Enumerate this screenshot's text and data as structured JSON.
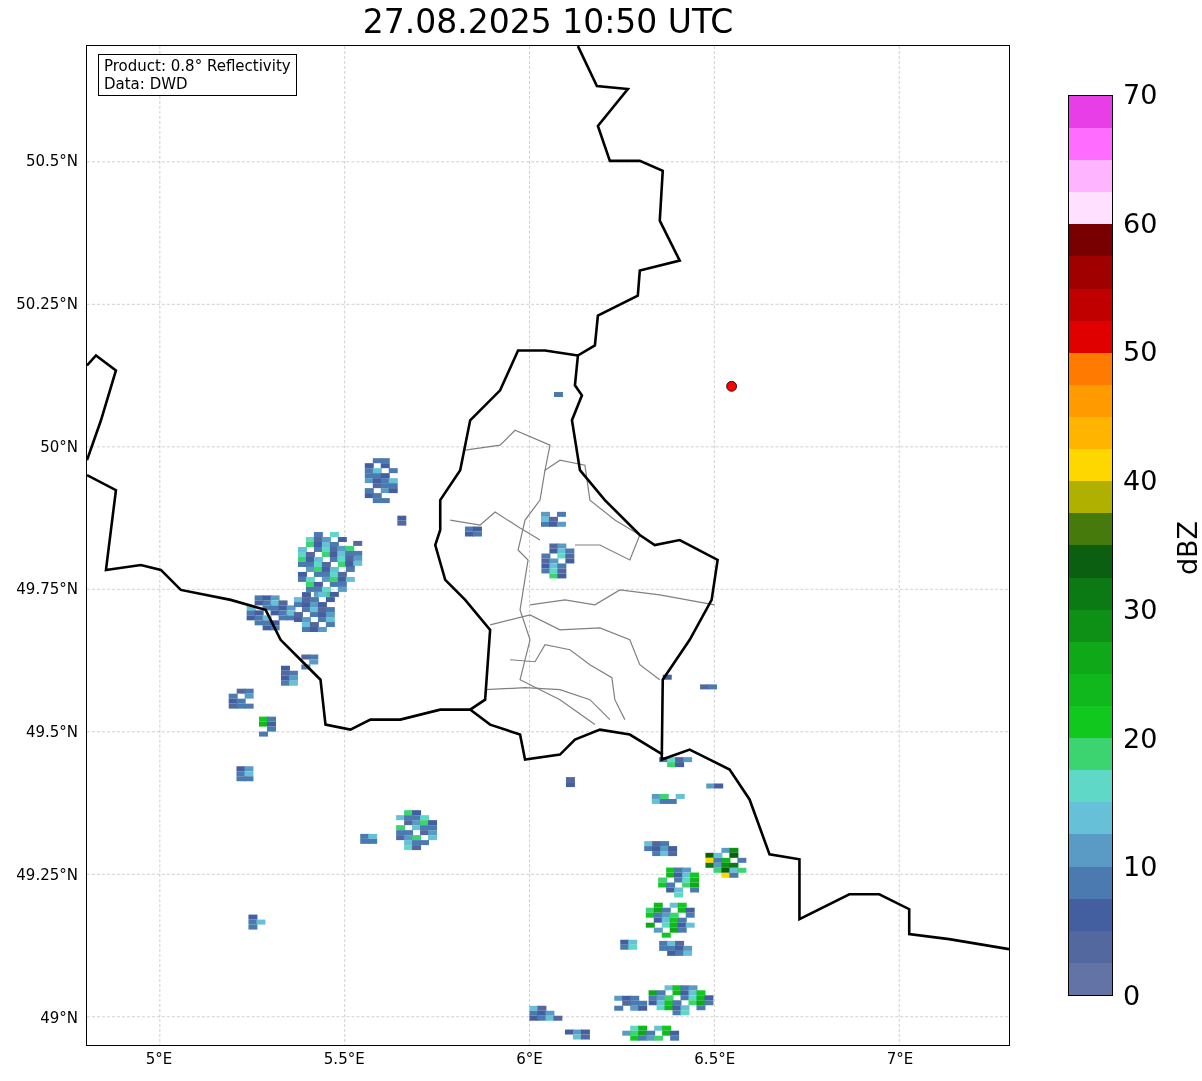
{
  "title": "27.08.2025 10:50 UTC",
  "info_box": {
    "lines": [
      "Product: 0.8° Reflectivity",
      "Data: DWD"
    ]
  },
  "map": {
    "yticks": [
      "50.5°N",
      "50.25°N",
      "50°N",
      "49.75°N",
      "49.5°N",
      "49.25°N",
      "49°N"
    ],
    "xticks": [
      "5°E",
      "5.5°E",
      "6°E",
      "6.5°E",
      "7°E"
    ]
  },
  "colorbar": {
    "label": "dBZ",
    "ticks": [
      "70",
      "60",
      "50",
      "40",
      "30",
      "20",
      "10",
      "0"
    ],
    "bands": [
      {
        "color": "#6473a6"
      },
      {
        "color": "#5468a0"
      },
      {
        "color": "#445fa0"
      },
      {
        "color": "#4a7ab0"
      },
      {
        "color": "#5a9bc5"
      },
      {
        "color": "#66c0d8"
      },
      {
        "color": "#60d8c8"
      },
      {
        "color": "#3cd470"
      },
      {
        "color": "#10c81e"
      },
      {
        "color": "#10b81e"
      },
      {
        "color": "#0fa818"
      },
      {
        "color": "#0e9016"
      },
      {
        "color": "#0c7a14"
      },
      {
        "color": "#0a6010"
      },
      {
        "color": "#467a0c"
      },
      {
        "color": "#b0b000"
      },
      {
        "color": "#ffd700"
      },
      {
        "color": "#ffb400"
      },
      {
        "color": "#ff9a00"
      },
      {
        "color": "#ff7a00"
      },
      {
        "color": "#e00000"
      },
      {
        "color": "#c00000"
      },
      {
        "color": "#a00000"
      },
      {
        "color": "#780000"
      },
      {
        "color": "#ffe0ff"
      },
      {
        "color": "#ffb4ff"
      },
      {
        "color": "#ff6cff"
      },
      {
        "color": "#e83ee8"
      }
    ]
  }
}
